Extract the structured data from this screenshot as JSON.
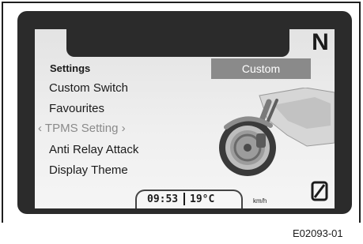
{
  "display": {
    "gear": "N",
    "menu_title": "Settings",
    "mode_chip": "Custom",
    "menu_items": [
      {
        "label": "Custom Switch",
        "selected": false
      },
      {
        "label": "Favourites",
        "selected": false
      },
      {
        "label": "TPMS Setting",
        "selected": true,
        "prefix": "‹ ",
        "suffix": " ›"
      },
      {
        "label": "Anti Relay Attack",
        "selected": false
      },
      {
        "label": "Display Theme",
        "selected": false
      }
    ],
    "status": {
      "time": "09:53",
      "temperature": "19°C",
      "speed_unit": "km/h"
    },
    "icons": {
      "odometer": "zero-slash-icon",
      "vehicle": "motorcycle-front-icon"
    }
  },
  "figure_code": "E02093-01",
  "colors": {
    "bezel": "#2b2b2b",
    "chip": "#8a8a8a",
    "selected_text": "#8a8a8a",
    "text": "#1b1b1b"
  }
}
